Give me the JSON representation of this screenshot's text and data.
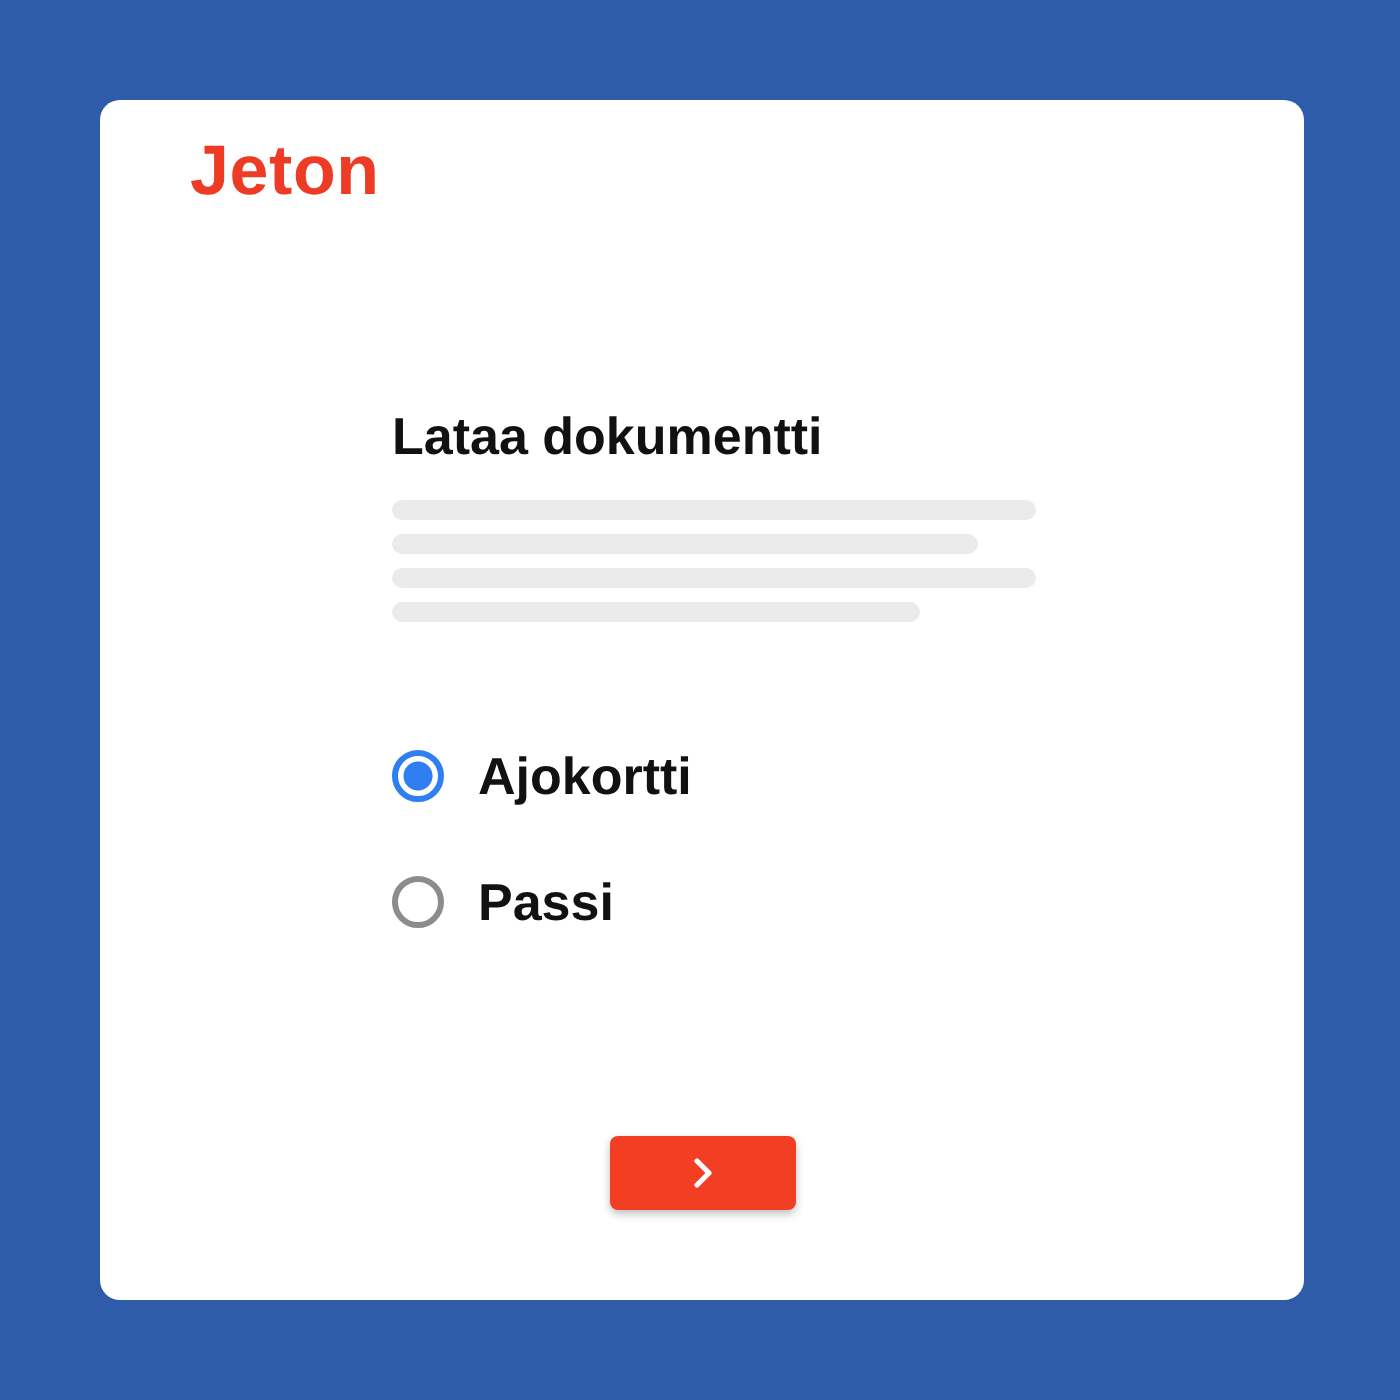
{
  "logo": {
    "text": "Jeton"
  },
  "title": "Lataa dokumentti",
  "options": [
    {
      "label": "Ajokortti",
      "selected": true
    },
    {
      "label": "Passi",
      "selected": false
    }
  ]
}
